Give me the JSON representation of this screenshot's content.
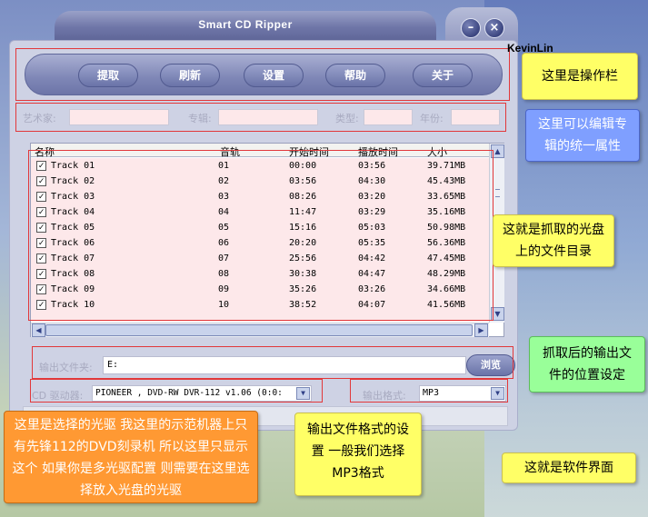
{
  "window": {
    "title": "Smart CD Ripper",
    "minimize": "–",
    "close": "×"
  },
  "toolbar": {
    "buttons": [
      "提取",
      "刷新",
      "设置",
      "帮助",
      "关于"
    ]
  },
  "properties": {
    "artist_label": "艺术家:",
    "album_label": "专辑:",
    "genre_label": "类型:",
    "year_label": "年份:"
  },
  "track_list": {
    "columns": [
      "名称",
      "音轨",
      "开始时间",
      "播放时间",
      "大小"
    ],
    "rows": [
      {
        "name": "Track 01",
        "track": "01",
        "start": "00:00",
        "duration": "03:56",
        "size": "39.71MB"
      },
      {
        "name": "Track 02",
        "track": "02",
        "start": "03:56",
        "duration": "04:30",
        "size": "45.43MB"
      },
      {
        "name": "Track 03",
        "track": "03",
        "start": "08:26",
        "duration": "03:20",
        "size": "33.65MB"
      },
      {
        "name": "Track 04",
        "track": "04",
        "start": "11:47",
        "duration": "03:29",
        "size": "35.16MB"
      },
      {
        "name": "Track 05",
        "track": "05",
        "start": "15:16",
        "duration": "05:03",
        "size": "50.98MB"
      },
      {
        "name": "Track 06",
        "track": "06",
        "start": "20:20",
        "duration": "05:35",
        "size": "56.36MB"
      },
      {
        "name": "Track 07",
        "track": "07",
        "start": "25:56",
        "duration": "04:42",
        "size": "47.45MB"
      },
      {
        "name": "Track 08",
        "track": "08",
        "start": "30:38",
        "duration": "04:47",
        "size": "48.29MB"
      },
      {
        "name": "Track 09",
        "track": "09",
        "start": "35:26",
        "duration": "03:26",
        "size": "34.66MB"
      },
      {
        "name": "Track 10",
        "track": "10",
        "start": "38:52",
        "duration": "04:07",
        "size": "41.56MB"
      }
    ],
    "checkmark": "✓"
  },
  "output": {
    "folder_label": "输出文件夹:",
    "folder_value": "E:",
    "browse_label": "浏览"
  },
  "drive": {
    "label": "CD 驱动器:",
    "value": "PIONEER , DVD-RW  DVR-112  v1.06 (0:0:"
  },
  "format": {
    "label": "输出格式:",
    "value": "MP3"
  },
  "annotations": {
    "author": "KevinLin",
    "toolbar_note": "这里是操作栏",
    "props_note": "这里可以编辑专辑的统一属性",
    "list_note": "这就是抓取的光盘上的文件目录",
    "output_note": "抓取后的输出文件的位置设定",
    "drive_note": "这里是选择的光驱 我这里的示范机器上只有先锋112的DVD刻录机 所以这里只显示这个 如果你是多光驱配置 则需要在这里选择放入光盘的光驱",
    "format_note": "输出文件格式的设置 一般我们选择MP3格式",
    "window_note": "这就是软件界面"
  },
  "colors": {
    "annotation_border": "#e2383a",
    "list_background": "#fde8ea",
    "callout_yellow": "#ffff66",
    "callout_blue": "#7f9fff",
    "callout_green": "#99ff99",
    "callout_orange": "#ff9933"
  }
}
